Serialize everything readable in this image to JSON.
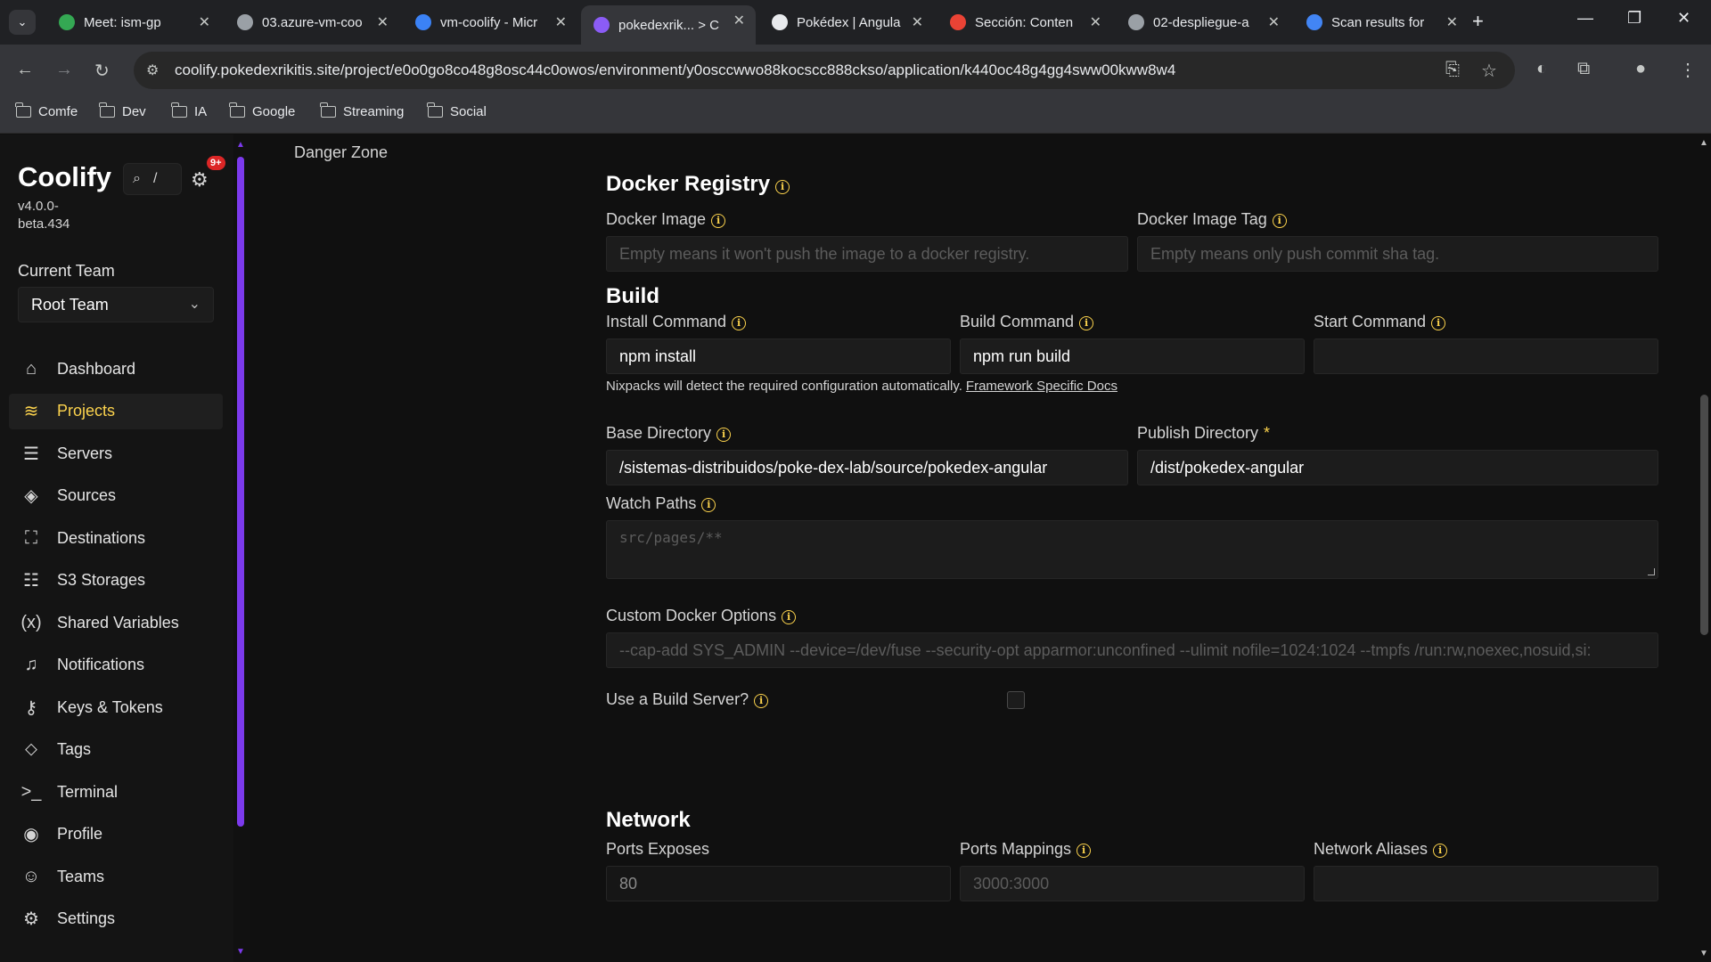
{
  "browser": {
    "tabs": [
      {
        "title": "Meet: ism-gp",
        "favicon": "meet-icon",
        "color": "#34a853"
      },
      {
        "title": "03.azure-vm-coo",
        "favicon": "globe-icon",
        "color": "#9aa0a6"
      },
      {
        "title": "vm-coolify - Micr",
        "favicon": "azure-icon",
        "color": "#3b82f6"
      },
      {
        "title": "pokedexrik... > C",
        "favicon": "coolify-icon",
        "color": "#8b5cf6"
      },
      {
        "title": "Pokédex | Angula",
        "favicon": "angular-icon",
        "color": "#e8eaed"
      },
      {
        "title": "Sección: Conten",
        "favicon": "red-circle-icon",
        "color": "#ea4335"
      },
      {
        "title": "02-despliegue-a",
        "favicon": "globe-icon",
        "color": "#9aa0a6"
      },
      {
        "title": "Scan results for",
        "favicon": "scan-icon",
        "color": "#4285f4"
      }
    ],
    "url": "coolify.pokedexrikitis.site/project/e0o0go8co48g8osc44c0owos/environment/y0osccwwo88kocscc888ckso/application/k440oc48g4gg4sww00kww8w4",
    "bookmarks": [
      "Comfe",
      "Dev",
      "IA",
      "Google",
      "Streaming",
      "Social"
    ]
  },
  "sidebar": {
    "brand": "Coolify",
    "version": "v4.0.0-beta.434",
    "search_hint": "/",
    "notifications_badge": "9+",
    "team_label": "Current Team",
    "team_value": "Root Team",
    "items": [
      {
        "label": "Dashboard",
        "icon": "home-icon",
        "glyph": "⌂",
        "active": false
      },
      {
        "label": "Projects",
        "icon": "layers-icon",
        "glyph": "≋",
        "active": true
      },
      {
        "label": "Servers",
        "icon": "server-icon",
        "glyph": "☰",
        "active": false
      },
      {
        "label": "Sources",
        "icon": "git-icon",
        "glyph": "◈",
        "active": false
      },
      {
        "label": "Destinations",
        "icon": "map-icon",
        "glyph": "⛶",
        "active": false
      },
      {
        "label": "S3 Storages",
        "icon": "database-icon",
        "glyph": "☷",
        "active": false
      },
      {
        "label": "Shared Variables",
        "icon": "variable-icon",
        "glyph": "(x)",
        "active": false
      },
      {
        "label": "Notifications",
        "icon": "bell-icon",
        "glyph": "♫",
        "active": false
      },
      {
        "label": "Keys & Tokens",
        "icon": "key-icon",
        "glyph": "⚷",
        "active": false
      },
      {
        "label": "Tags",
        "icon": "tag-icon",
        "glyph": "⬦",
        "active": false
      },
      {
        "label": "Terminal",
        "icon": "terminal-icon",
        "glyph": ">_",
        "active": false
      },
      {
        "label": "Profile",
        "icon": "profile-icon",
        "glyph": "◉",
        "active": false
      },
      {
        "label": "Teams",
        "icon": "users-icon",
        "glyph": "☺",
        "active": false
      },
      {
        "label": "Settings",
        "icon": "settings-icon",
        "glyph": "⚙",
        "active": false
      }
    ]
  },
  "main": {
    "side_menu_item": "Danger Zone",
    "docker_registry": {
      "title": "Docker Registry",
      "image_label": "Docker Image",
      "image_placeholder": "Empty means it won't push the image to a docker registry.",
      "tag_label": "Docker Image Tag",
      "tag_placeholder": "Empty means only push commit sha tag."
    },
    "build": {
      "title": "Build",
      "install_label": "Install Command",
      "install_value": "npm install",
      "build_label": "Build Command",
      "build_value": "npm run build",
      "start_label": "Start Command",
      "start_value": "",
      "hint": "Nixpacks will detect the required configuration automatically.",
      "hint_link": "Framework Specific Docs",
      "base_dir_label": "Base Directory",
      "base_dir_value": "/sistemas-distribuidos/poke-dex-lab/source/pokedex-angular",
      "publish_dir_label": "Publish Directory",
      "publish_dir_value": "/dist/pokedex-angular",
      "watch_label": "Watch Paths",
      "watch_placeholder": "src/pages/**",
      "docker_opts_label": "Custom Docker Options",
      "docker_opts_placeholder": "--cap-add SYS_ADMIN --device=/dev/fuse --security-opt apparmor:unconfined --ulimit nofile=1024:1024 --tmpfs /run:rw,noexec,nosuid,si:",
      "build_server_label": "Use a Build Server?",
      "build_server_checked": false
    },
    "network": {
      "title": "Network",
      "ports_exposes_label": "Ports Exposes",
      "ports_exposes_value": "80",
      "ports_mappings_label": "Ports Mappings",
      "ports_mappings_placeholder": "3000:3000",
      "aliases_label": "Network Aliases",
      "aliases_value": ""
    }
  }
}
